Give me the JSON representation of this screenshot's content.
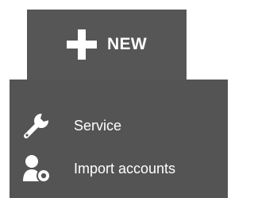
{
  "new_button": {
    "label": "NEW",
    "icon": "plus-icon"
  },
  "menu": {
    "items": [
      {
        "label": "Service",
        "icon": "wrench-icon"
      },
      {
        "label": "Import accounts",
        "icon": "user-import-icon"
      }
    ]
  },
  "colors": {
    "tab_background": "#565656",
    "menu_background": "#545454",
    "text": "#ffffff"
  }
}
